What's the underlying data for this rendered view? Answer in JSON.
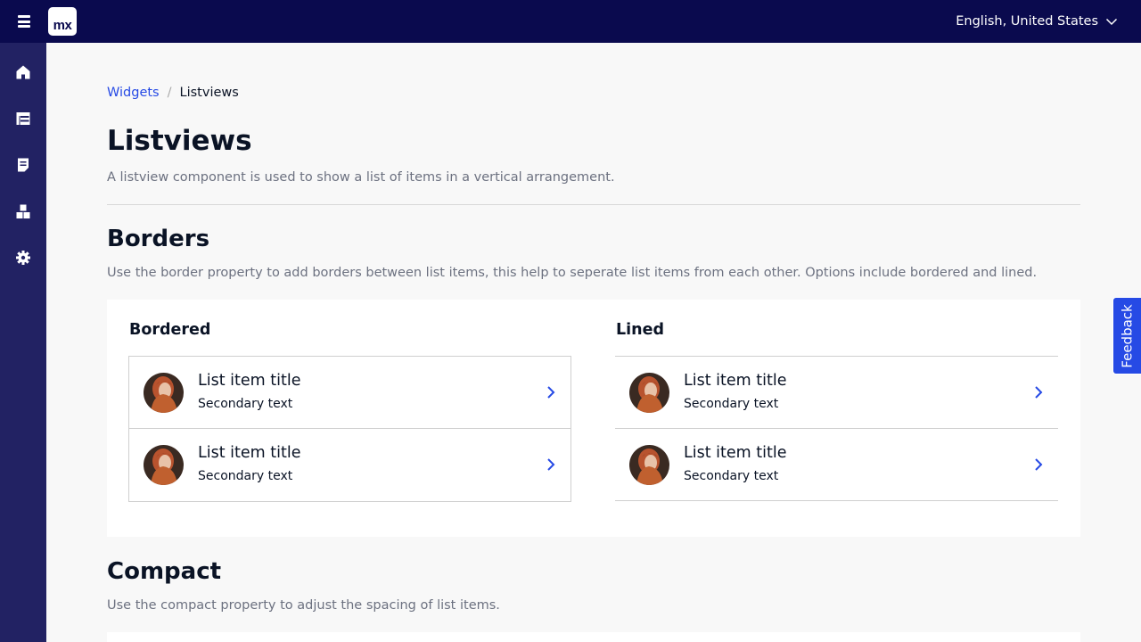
{
  "header": {
    "logo_text": "mx",
    "language": "English, United States"
  },
  "sidenav": {
    "items": [
      "home-icon",
      "table-icon",
      "document-icon",
      "widgets-icon",
      "settings-icon"
    ]
  },
  "breadcrumb": {
    "parent": "Widgets",
    "separator": "/",
    "current": "Listviews"
  },
  "page": {
    "title": "Listviews",
    "description": "A listview component is used to show a list of items in a vertical arrangement."
  },
  "borders": {
    "title": "Borders",
    "description": "Use the border property to add borders between list items, this help to seperate list items from each other. Options include bordered and lined.",
    "columns": [
      {
        "label": "Bordered",
        "items": [
          {
            "title": "List item title",
            "secondary": "Secondary text"
          },
          {
            "title": "List item title",
            "secondary": "Secondary text"
          }
        ]
      },
      {
        "label": "Lined",
        "items": [
          {
            "title": "List item title",
            "secondary": "Secondary text"
          },
          {
            "title": "List item title",
            "secondary": "Secondary text"
          }
        ]
      }
    ]
  },
  "compact": {
    "title": "Compact",
    "description": "Use the compact property to adjust the spacing of list items."
  },
  "feedback": {
    "label": "Feedback"
  },
  "colors": {
    "topbar": "#0a0a4e",
    "sidenav": "#222263",
    "accent": "#264ae5"
  }
}
